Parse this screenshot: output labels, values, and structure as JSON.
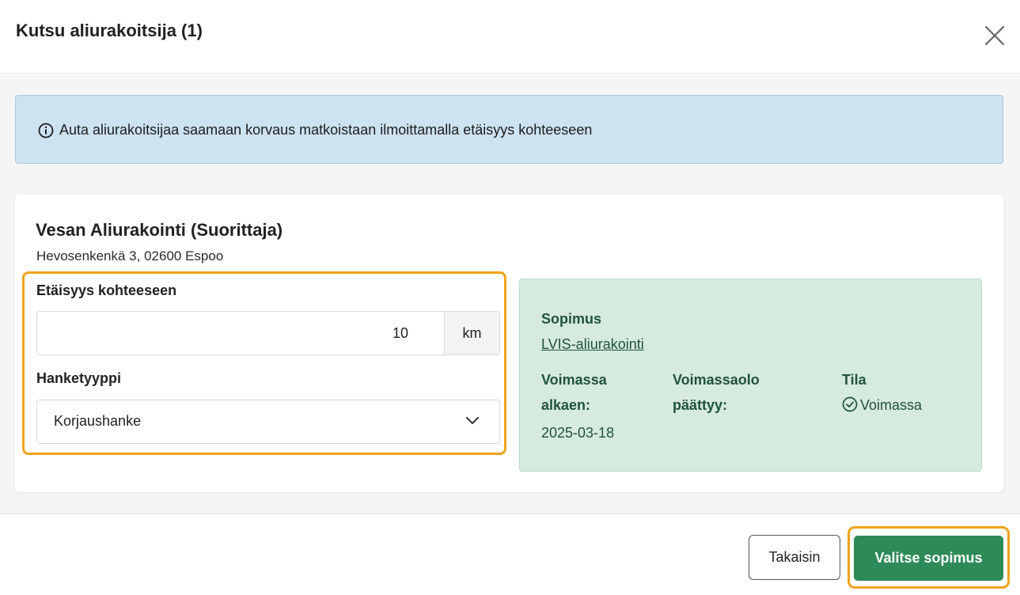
{
  "dialog": {
    "title": "Kutsu aliurakoitsija (1)"
  },
  "info_banner": {
    "text": "Auta aliurakoitsijaa saamaan korvaus matkoistaan ilmoittamalla etäisyys kohteeseen"
  },
  "subcontractor": {
    "name": "Vesan Aliurakointi (Suorittaja)",
    "address": "Hevosenkenkä 3, 02600 Espoo"
  },
  "form": {
    "distance_label": "Etäisyys kohteeseen",
    "distance_value": "10",
    "distance_unit": "km",
    "project_type_label": "Hanketyyppi",
    "project_type_value": "Korjaushanke"
  },
  "contract": {
    "label": "Sopimus",
    "name": "LVIS-aliurakointi",
    "valid_from_label_line1": "Voimassa",
    "valid_from_label_line2": "alkaen:",
    "valid_from_value": "2025-03-18",
    "valid_until_label_line1": "Voimassaolo",
    "valid_until_label_line2": "päättyy:",
    "status_label": "Tila",
    "status_value": "Voimassa"
  },
  "footer": {
    "back_label": "Takaisin",
    "select_label": "Valitse sopimus"
  },
  "colors": {
    "info_bg": "#cde3f1",
    "contract_bg": "#d6eadf",
    "contract_text": "#21543a",
    "primary_button": "#2e8b57",
    "highlight_outline": "#f0a31b"
  },
  "icons": {
    "close": "close-icon",
    "info": "info-circle-icon",
    "chevron": "chevron-down-icon",
    "status": "check-circle-icon"
  }
}
